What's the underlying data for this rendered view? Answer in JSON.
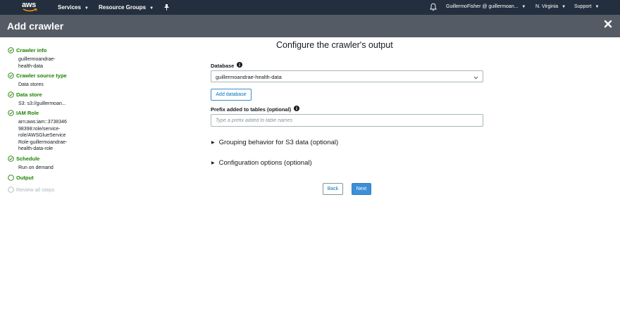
{
  "nav": {
    "logo_text": "aws",
    "services_label": "Services",
    "resource_groups_label": "Resource Groups",
    "account_label": "GuillermoFisher @ guillermoan...",
    "region_label": "N. Virginia",
    "support_label": "Support"
  },
  "header": {
    "title": "Add crawler"
  },
  "sidebar": {
    "steps": [
      {
        "label": "Crawler info",
        "detail": [
          "guillermoandrae-",
          "health-data"
        ],
        "status": "complete"
      },
      {
        "label": "Crawler source type",
        "detail": [
          "Data stores"
        ],
        "status": "complete"
      },
      {
        "label": "Data store",
        "detail": [
          "S3: s3://guillermoan..."
        ],
        "status": "complete"
      },
      {
        "label": "IAM Role",
        "detail": [
          "arn:aws:iam::3738346",
          "98398:role/service-",
          "role/AWSGlueService",
          "Role-guillermoandrae-",
          "health-data-role"
        ],
        "status": "complete"
      },
      {
        "label": "Schedule",
        "detail": [
          "Run on demand"
        ],
        "status": "complete"
      },
      {
        "label": "Output",
        "detail": [],
        "status": "current"
      },
      {
        "label": "Review all steps",
        "detail": [],
        "status": "disabled"
      }
    ]
  },
  "main": {
    "title": "Configure the crawler's output",
    "database_label": "Database",
    "database_value": "guillermoandrae-health-data",
    "add_database_label": "Add database",
    "prefix_label": "Prefix added to tables (optional)",
    "prefix_placeholder": "Type a prefix added to table names",
    "prefix_value": "",
    "grouping_label": "Grouping behavior for S3 data (optional)",
    "config_label": "Configuration options (optional)",
    "back_label": "Back",
    "next_label": "Next"
  },
  "colors": {
    "nav_bg": "#232f3e",
    "header_bg": "#545b64",
    "step_complete": "#1d8102",
    "step_disabled": "#aab7b8",
    "primary_button": "#3d8fd6",
    "link": "#0073bb"
  }
}
